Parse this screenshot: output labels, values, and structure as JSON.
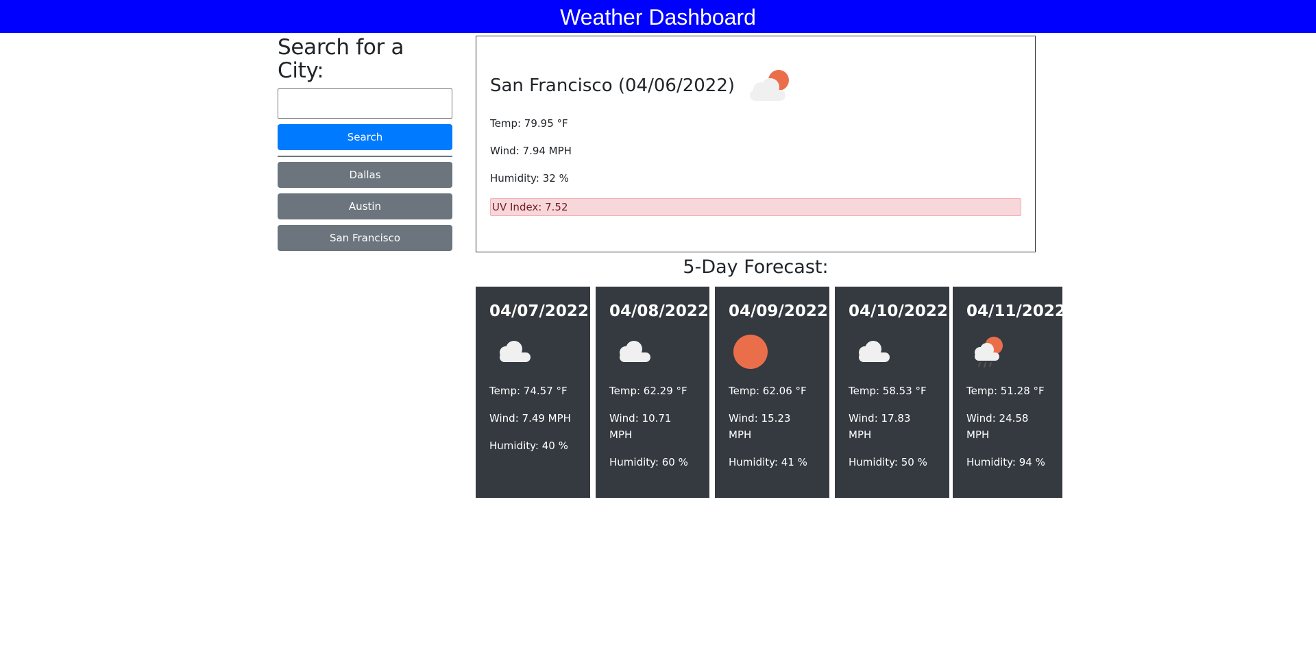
{
  "header": {
    "title": "Weather Dashboard"
  },
  "sidebar": {
    "title": "Search for a City:",
    "search_value": "",
    "search_button": "Search",
    "history": [
      "Dallas",
      "Austin",
      "San Francisco"
    ]
  },
  "current": {
    "title": "San Francisco (04/06/2022)",
    "icon": "partly-cloudy-day-icon",
    "temp": "Temp: 79.95 °F",
    "wind": "Wind: 7.94 MPH",
    "humidity": "Humidity: 32 %",
    "uv": "UV Index: 7.52"
  },
  "forecast": {
    "heading": "5-Day Forecast:",
    "days": [
      {
        "date": "04/07/2022",
        "icon": "cloud-icon",
        "temp": "Temp: 74.57 °F",
        "wind": "Wind: 7.49 MPH",
        "humidity": "Humidity: 40 %"
      },
      {
        "date": "04/08/2022",
        "icon": "cloud-icon",
        "temp": "Temp: 62.29 °F",
        "wind": "Wind: 10.71 MPH",
        "humidity": "Humidity: 60 %"
      },
      {
        "date": "04/09/2022",
        "icon": "sun-icon",
        "temp": "Temp: 62.06 °F",
        "wind": "Wind: 15.23 MPH",
        "humidity": "Humidity: 41 %"
      },
      {
        "date": "04/10/2022",
        "icon": "cloud-icon",
        "temp": "Temp: 58.53 °F",
        "wind": "Wind: 17.83 MPH",
        "humidity": "Humidity: 50 %"
      },
      {
        "date": "04/11/2022",
        "icon": "rain-sun-icon",
        "temp": "Temp: 51.28 °F",
        "wind": "Wind: 24.58 MPH",
        "humidity": "Humidity: 94 %"
      }
    ]
  },
  "colors": {
    "header_bg": "#0000ff",
    "search_button": "#007bff",
    "history_button": "#6c757d",
    "forecast_card": "#343a40",
    "uv_bg": "#f8d7da",
    "sun": "#eb6e4b",
    "cloud": "#f0f0f0"
  }
}
